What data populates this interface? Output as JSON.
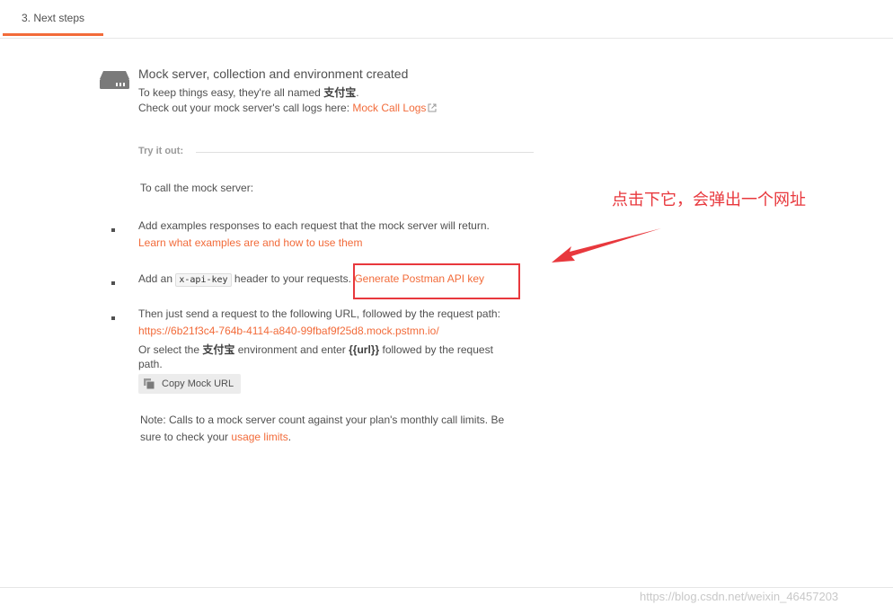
{
  "tab": {
    "label": "3. Next steps"
  },
  "header": {
    "icon": "server-icon",
    "title": "Mock server, collection and environment created",
    "line1_prefix": "To keep things easy, they're all named ",
    "line1_name": "支付宝",
    "line1_suffix": ".",
    "line2_prefix": "Check out your mock server's call logs here: ",
    "line2_link": "Mock Call Logs"
  },
  "try_it_out": {
    "label": "Try it out:",
    "intro": "To call the mock server:",
    "step1": {
      "text": "Add examples responses to each request that the mock server will return.",
      "link": "Learn what examples are and how to use them"
    },
    "step2": {
      "prefix": "Add an ",
      "code": "x-api-key",
      "suffix": " header to your requests. ",
      "link": "Generate Postman API key"
    },
    "step3": {
      "text": "Then just send a request to the following URL, followed by the request path:",
      "url": "https://6b21f3c4-764b-4114-a840-99fbaf9f25d8.mock.pstmn.io/",
      "alt_prefix": "Or select the ",
      "alt_env": "支付宝",
      "alt_middle": " environment and enter ",
      "alt_var": "{{url}}",
      "alt_suffix": " followed by the request",
      "alt_line2": "path.",
      "copy_button": "Copy Mock URL"
    },
    "note": {
      "line1": "Note: Calls to a mock server count against your plan's monthly call limits. Be",
      "line2_prefix": "sure to check your ",
      "line2_link": "usage limits",
      "line2_suffix": "."
    }
  },
  "annotation": {
    "text": "点击下它，会弹出一个网址",
    "color": "#e8383d"
  },
  "watermark": {
    "text": "https://blog.csdn.net/weixin_46457203"
  },
  "colors": {
    "accent": "#f26b3a",
    "annotation_red": "#e8383d"
  }
}
